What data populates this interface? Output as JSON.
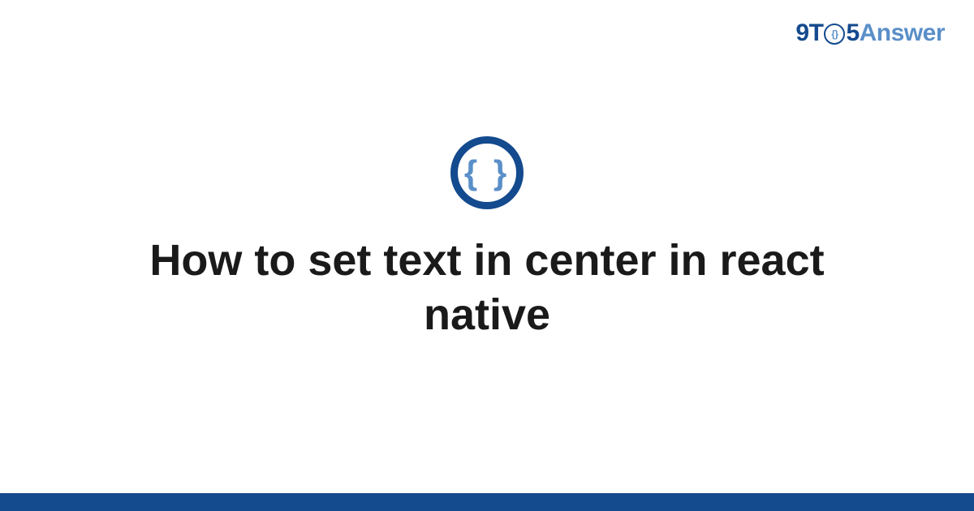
{
  "brand": {
    "part1": "9",
    "part2": "T",
    "circle_inner": "{}",
    "part3": "5",
    "part4": "Answer"
  },
  "icon": {
    "glyph": "{ }"
  },
  "title": "How to set text in center in react native",
  "colors": {
    "primary": "#144a8e",
    "accent": "#5a8fc8",
    "text": "#1a1a1a",
    "background": "#ffffff"
  }
}
